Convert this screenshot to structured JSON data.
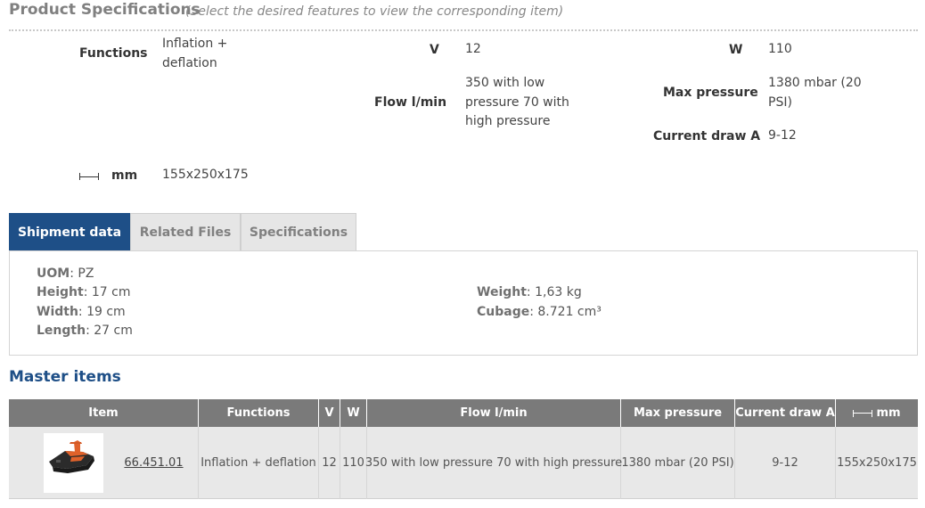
{
  "specs": {
    "title": "Product Specifications",
    "subtitle": "(Select the desired features to view the corresponding item)",
    "functions_label": "Functions",
    "functions_value": "Inflation + deflation",
    "v_label": "V",
    "v_value": "12",
    "w_label": "W",
    "w_value": "110",
    "flow_label": "Flow l/min",
    "flow_value": "350 with low pressure 70 with high pressure",
    "max_pressure_label": "Max pressure",
    "max_pressure_value": "1380 mbar (20 PSI)",
    "current_label": "Current draw A",
    "current_value": "9-12",
    "dim_icon": "dimension-arrow-icon",
    "mm_label": "mm",
    "mm_value": "155x250x175"
  },
  "tabs": [
    {
      "label": "Shipment data",
      "active": true
    },
    {
      "label": "Related Files",
      "active": false
    },
    {
      "label": "Specifications",
      "active": false
    }
  ],
  "shipment": {
    "uom_label": "UOM",
    "uom_value": ": PZ",
    "height_label": "Height",
    "height_value": ": 17 cm",
    "width_label": "Width",
    "width_value": ": 19 cm",
    "length_label": "Length",
    "length_value": ": 27 cm",
    "weight_label": "Weight",
    "weight_value": ": 1,63 kg",
    "cubage_label": "Cubage",
    "cubage_value": ": 8.721 cm³"
  },
  "master": {
    "title": "Master items",
    "columns": [
      "Item",
      "Functions",
      "V",
      "W",
      "Flow l/min",
      "Max pressure",
      "Current draw A",
      "mm"
    ],
    "rows": [
      {
        "item_code": "66.451.01",
        "functions": "Inflation + deflation",
        "v": "12",
        "w": "110",
        "flow": "350 with low pressure 70 with high pressure",
        "max_pressure": "1380 mbar (20 PSI)",
        "current": "9-12",
        "mm": "155x250x175"
      }
    ]
  },
  "colors": {
    "accent": "#1e4f87",
    "table_header": "#7a7a7a",
    "row_bg": "#e8e8e8"
  }
}
